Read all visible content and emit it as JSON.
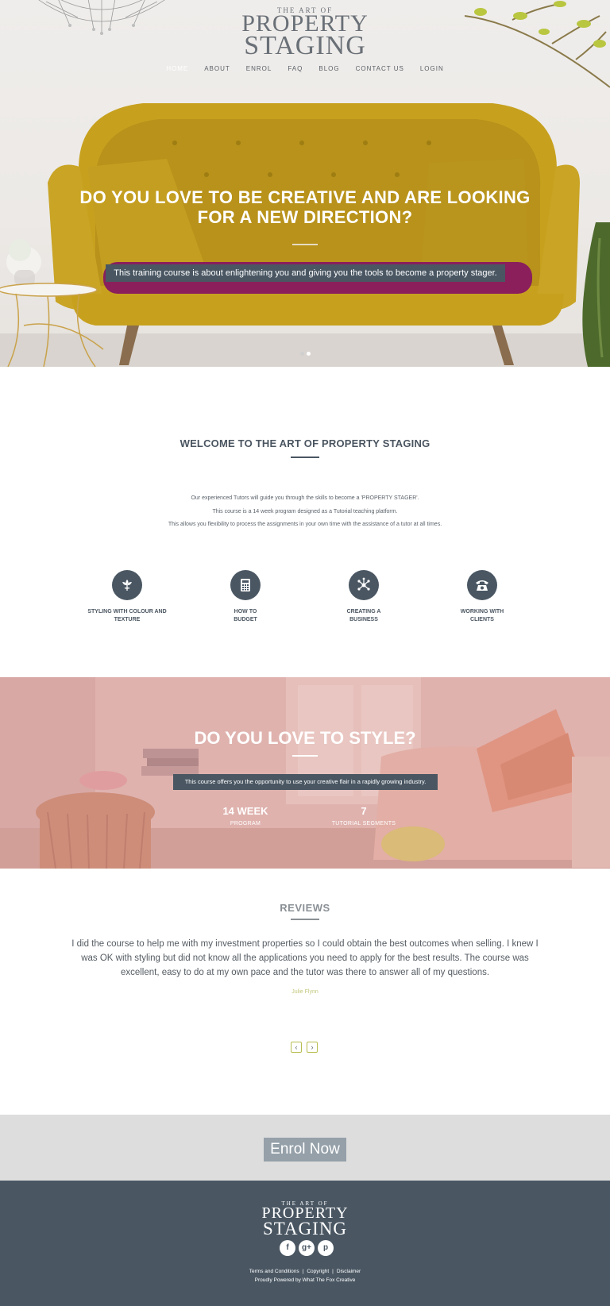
{
  "logo": {
    "small": "THE ART OF",
    "line1": "PROPERTY",
    "line2": "STAGING"
  },
  "nav": [
    "HOME",
    "ABOUT",
    "ENROL",
    "FAQ",
    "BLOG",
    "CONTACT US",
    "LOGIN"
  ],
  "hero": {
    "title": "DO YOU LOVE TO BE CREATIVE AND ARE LOOKING FOR A NEW DIRECTION?",
    "banner": "This training course is about enlightening you and giving you the tools to become a property stager."
  },
  "welcome": {
    "title": "WELCOME TO THE ART OF PROPERTY STAGING",
    "lines": [
      "Our experienced Tutors will guide you through the skills to become a 'PROPERTY STAGER'.",
      "This course is a 14 week program designed as a Tutorial teaching platform.",
      "This allows you flexibility to process the assignments in your own time with the assistance of a tutor at all times."
    ]
  },
  "features": [
    {
      "icon": "flower-icon",
      "line1": "STYLING WITH COLOUR AND",
      "line2": "TEXTURE"
    },
    {
      "icon": "calculator-icon",
      "line1": "HOW TO",
      "line2": "BUDGET"
    },
    {
      "icon": "network-icon",
      "line1": "CREATING A",
      "line2": "BUSINESS"
    },
    {
      "icon": "telephone-icon",
      "line1": "WORKING WITH",
      "line2": "CLIENTS"
    }
  ],
  "style_band": {
    "title": "DO YOU LOVE TO STYLE?",
    "banner": "This course offers you the opportunity to use your creative flair in a rapidly growing industry.",
    "stats": [
      {
        "num": "14 WEEK",
        "cap": "PROGRAM"
      },
      {
        "num": "7",
        "cap": "TUTORIAL SEGMENTS"
      }
    ]
  },
  "reviews": {
    "title": "REVIEWS",
    "text": "I did the course to help me with my investment properties so I could obtain the best outcomes when selling. I knew I was OK with styling but did not know all the applications you need to apply for the best results. The course was excellent, easy to do at my own pace and the tutor was there to answer all of my questions.",
    "author": "Julie Flynn",
    "prev": "‹",
    "next": "›"
  },
  "enrol": {
    "label": "Enrol Now"
  },
  "footer": {
    "links": [
      "Terms and Conditions",
      "Copyright",
      "Disclaimer"
    ],
    "powered": "Proudly Powered by What The Fox Creative",
    "social": [
      "f",
      "g+",
      "p"
    ]
  },
  "colors": {
    "slate": "#4a5763",
    "mustard": "#c9a21f",
    "magenta": "#8a1f5c",
    "band_pink": "#d9aeaa",
    "enrol_grey": "#95a0a9"
  }
}
